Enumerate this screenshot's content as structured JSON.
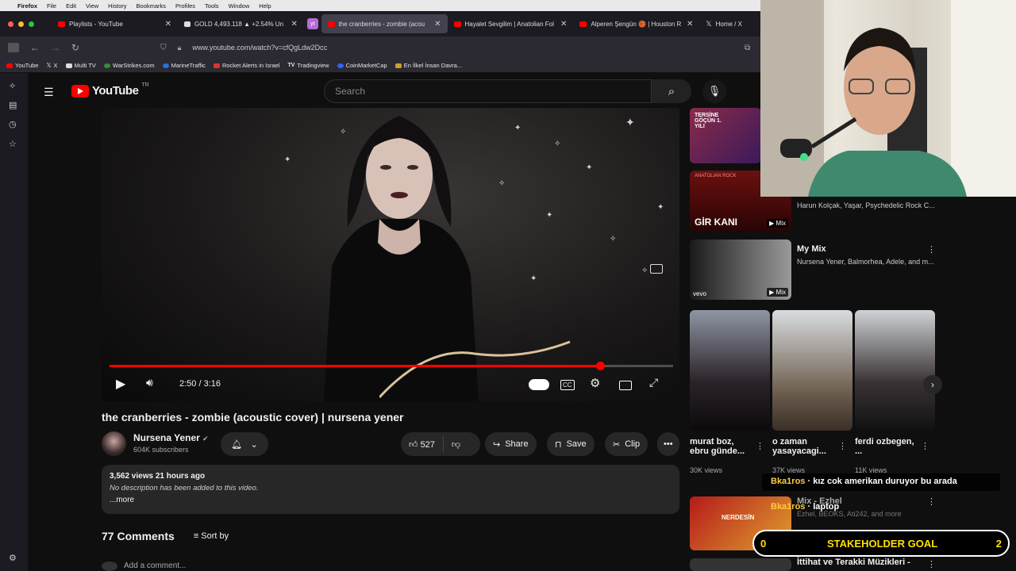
{
  "menubar": {
    "app": "Firefox",
    "items": [
      "File",
      "Edit",
      "View",
      "History",
      "Bookmarks",
      "Profiles",
      "Tools",
      "Window",
      "Help"
    ]
  },
  "tabs": [
    {
      "title": "Playlists - YouTube",
      "fav": "#f00"
    },
    {
      "title": "GOLD 4,493.118 ▲ +2.54% Un",
      "fav": "#ddd"
    },
    {
      "title": "the cranberries - zombie (acou",
      "fav": "#f00",
      "active": true
    },
    {
      "title": "Hayalet Sevgilim | Anatolian Fol",
      "fav": "#f00"
    },
    {
      "title": "Alperen Şengün 🏀 | Houston R",
      "fav": "#f00"
    },
    {
      "title": "Home / X",
      "fav": "#fff"
    }
  ],
  "yt_badge": "yt",
  "url": "www.youtube.com/watch?v=cfQgLdw2Dcc",
  "bookmarks": [
    {
      "label": "YouTube",
      "color": "#f00"
    },
    {
      "label": "X",
      "color": "#fff"
    },
    {
      "label": "Multi TV",
      "color": "#ddd"
    },
    {
      "label": "WarStrikes.com",
      "color": "#3a8b3a"
    },
    {
      "label": "MarineTraffic",
      "color": "#2f6fd6"
    },
    {
      "label": "Rocket Alerts in Israel",
      "color": "#d33"
    },
    {
      "label": "Tradingview",
      "color": "#ddd"
    },
    {
      "label": "CoinMarketCap",
      "color": "#3861fb"
    },
    {
      "label": "En İlkel İnsan Davra...",
      "color": "#c9a227"
    }
  ],
  "header": {
    "logo": "YouTube",
    "region": "TR",
    "search_placeholder": "Search"
  },
  "player": {
    "time": "2:50 / 3:16",
    "progress": 0.87
  },
  "video": {
    "title": "the cranberries - zombie (acoustic cover) | nursena yener",
    "channel": "Nursena Yener",
    "subscribers": "604K subscribers",
    "likes": "527",
    "share": "Share",
    "save": "Save",
    "clip": "Clip",
    "meta": "3,562 views  21 hours ago",
    "description": "No description has been added to this video.",
    "more": "...more",
    "comments": "77 Comments",
    "sort": "Sort by",
    "add_comment": "Add a comment..."
  },
  "recs": {
    "harun": "Harun Kolçak, Yaşar, Psychedelic Rock C...",
    "mymix_title": "My Mix",
    "mymix_sub": "Nursena Yener, Balmorhea, Adele, and m...",
    "mix_label": "Mix",
    "girkani": "GİR KANI",
    "tersine": "TERSİNE GÖÇÜN 1. YILI",
    "anatolian": "ANATOLIAN ROCK",
    "vevo": "vevo",
    "shorts": [
      {
        "title": "murat boz, ebru günde...",
        "views": "30K views"
      },
      {
        "title": "o zaman yasayacagi...",
        "views": "37K views"
      },
      {
        "title": "ferdi ozbegen, ...",
        "views": "11K views"
      }
    ],
    "eznel_title": "Mix - Ezhel",
    "eznel_sub": "Ezhel, BEOKS, Ati242, and more",
    "ittihat": "İttihat ve Terakki Müzikleri -",
    "nerdesin": "NERDESİN"
  },
  "overlay": {
    "chat1_user": "Bka1ros",
    "chat1_msg": "kız cok amerikan duruyor bu arada",
    "chat2_user": "Bka1ros",
    "chat2_msg": "laptop",
    "goal_label": "STAKEHOLDER GOAL",
    "goal_left": "0",
    "goal_count": "2"
  }
}
